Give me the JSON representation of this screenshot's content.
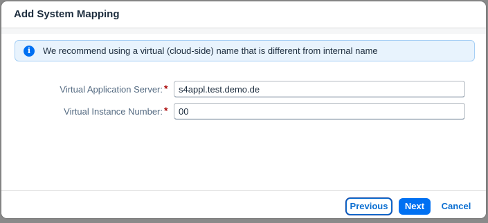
{
  "dialog": {
    "title": "Add System Mapping"
  },
  "message": {
    "icon": "info-icon",
    "glyph": "i",
    "text": "We recommend using a virtual (cloud-side) name that is different from internal name"
  },
  "form": {
    "required_marker": "*",
    "virtual_application_server": {
      "label": "Virtual Application Server:",
      "value": "s4appl.test.demo.de"
    },
    "virtual_instance_number": {
      "label": "Virtual Instance Number:",
      "value": "00"
    }
  },
  "footer": {
    "previous_label": "Previous",
    "next_label": "Next",
    "cancel_label": "Cancel"
  },
  "colors": {
    "accent": "#0070f2",
    "required": "#aa0808",
    "info_background": "#e8f3fd"
  }
}
